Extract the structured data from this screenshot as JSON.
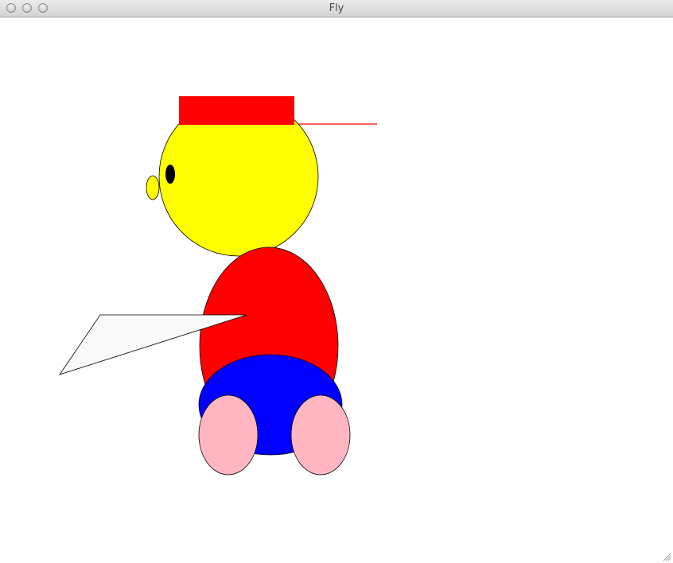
{
  "window": {
    "title": "Fly"
  },
  "colors": {
    "hat": "#ff0000",
    "head": "#ffff00",
    "body": "#ff0000",
    "shorts": "#0000ff",
    "feet": "#ffb6c1",
    "eye": "#000000",
    "wing": "#fafafa",
    "outline": "#000000"
  },
  "icons": {
    "window_controls": [
      "close-button-icon",
      "minimize-button-icon",
      "zoom-button-icon"
    ],
    "resize": "resize-grip-icon"
  }
}
